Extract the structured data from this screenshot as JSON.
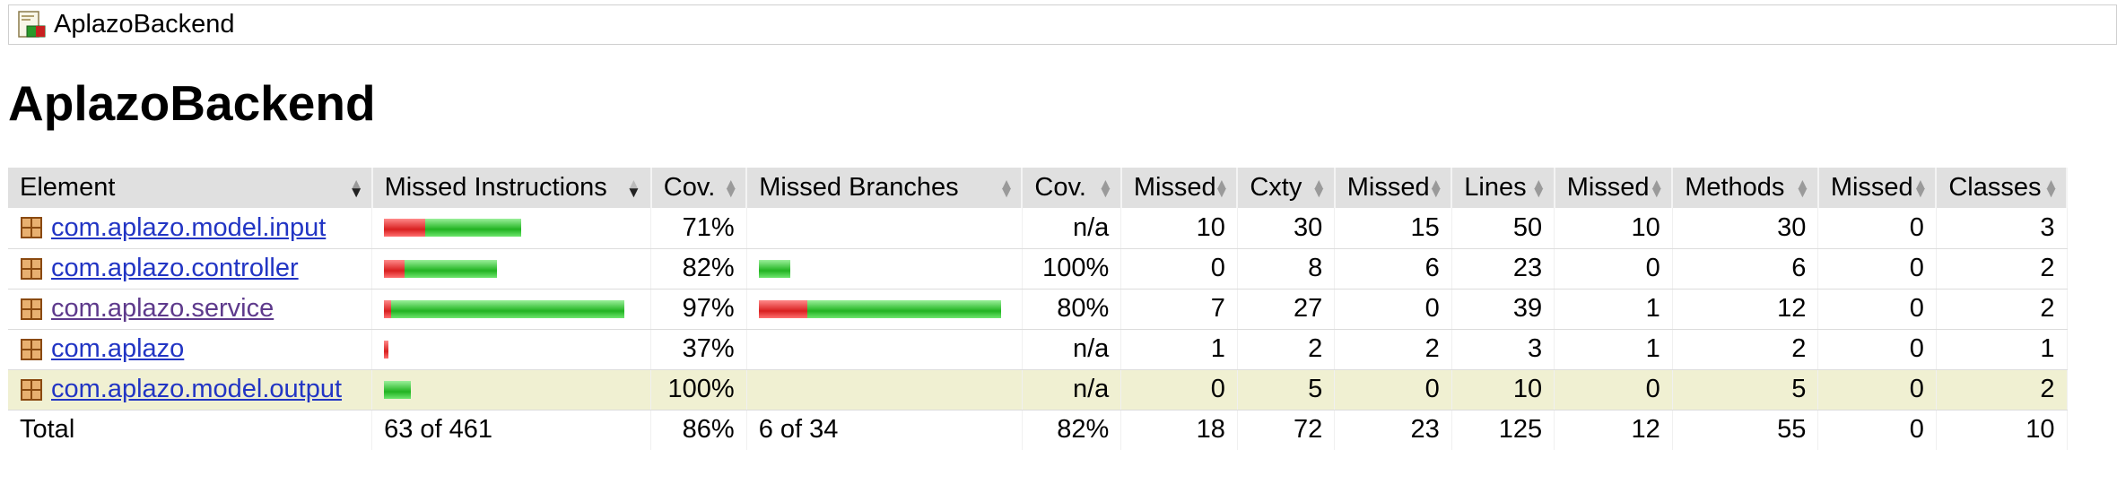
{
  "breadcrumb": {
    "label": "AplazoBackend"
  },
  "page": {
    "title": "AplazoBackend"
  },
  "headers": {
    "element": "Element",
    "missed_instructions": "Missed Instructions",
    "cov1": "Cov.",
    "missed_branches": "Missed Branches",
    "cov2": "Cov.",
    "missed_cxty": "Missed",
    "cxty": "Cxty",
    "missed_lines": "Missed",
    "lines": "Lines",
    "missed_methods": "Missed",
    "methods": "Methods",
    "missed_classes": "Missed",
    "classes": "Classes"
  },
  "rows": [
    {
      "name": "com.aplazo.model.input",
      "instr_red": 0.3,
      "instr_green": 0.7,
      "instr_scale": 0.57,
      "instr_cov": "71%",
      "br_red": 0,
      "br_green": 0,
      "br_scale": 0,
      "br_cov": "n/a",
      "missed_cxty": "10",
      "cxty": "30",
      "missed_lines": "15",
      "lines": "50",
      "missed_methods": "10",
      "methods": "30",
      "missed_classes": "0",
      "classes": "3"
    },
    {
      "name": "com.aplazo.controller",
      "instr_red": 0.18,
      "instr_green": 0.82,
      "instr_scale": 0.47,
      "instr_cov": "82%",
      "br_red": 0,
      "br_green": 1,
      "br_scale": 0.13,
      "br_cov": "100%",
      "missed_cxty": "0",
      "cxty": "8",
      "missed_lines": "6",
      "lines": "23",
      "missed_methods": "0",
      "methods": "6",
      "missed_classes": "0",
      "classes": "2"
    },
    {
      "name": "com.aplazo.service",
      "instr_red": 0.03,
      "instr_green": 0.97,
      "instr_scale": 1.0,
      "instr_cov": "97%",
      "br_red": 0.2,
      "br_green": 0.8,
      "br_scale": 1.0,
      "br_cov": "80%",
      "missed_cxty": "7",
      "cxty": "27",
      "missed_lines": "0",
      "lines": "39",
      "missed_methods": "1",
      "methods": "12",
      "missed_classes": "0",
      "classes": "2"
    },
    {
      "name": "com.aplazo",
      "instr_red": 1,
      "instr_green": 0,
      "instr_scale": 0.02,
      "instr_cov": "37%",
      "br_red": 0,
      "br_green": 0,
      "br_scale": 0,
      "br_cov": "n/a",
      "missed_cxty": "1",
      "cxty": "2",
      "missed_lines": "2",
      "lines": "3",
      "missed_methods": "1",
      "methods": "2",
      "missed_classes": "0",
      "classes": "1"
    },
    {
      "name": "com.aplazo.model.output",
      "instr_red": 0,
      "instr_green": 1,
      "instr_scale": 0.11,
      "instr_cov": "100%",
      "br_red": 0,
      "br_green": 0,
      "br_scale": 0,
      "br_cov": "n/a",
      "missed_cxty": "0",
      "cxty": "5",
      "missed_lines": "0",
      "lines": "10",
      "missed_methods": "0",
      "methods": "5",
      "missed_classes": "0",
      "classes": "2"
    }
  ],
  "total": {
    "label": "Total",
    "instr": "63 of 461",
    "instr_cov": "86%",
    "br": "6 of 34",
    "br_cov": "82%",
    "missed_cxty": "18",
    "cxty": "72",
    "missed_lines": "23",
    "lines": "125",
    "missed_methods": "12",
    "methods": "55",
    "missed_classes": "0",
    "classes": "10"
  },
  "icons": {
    "report": "report-icon",
    "package": "package-icon",
    "sort": "sort-icon"
  },
  "colors": {
    "bar_missed": "#d82020",
    "bar_covered": "#21b321",
    "link": "#2235c4",
    "highlight_row": "#f0f0d2",
    "header_bg": "#e0e0e0"
  }
}
